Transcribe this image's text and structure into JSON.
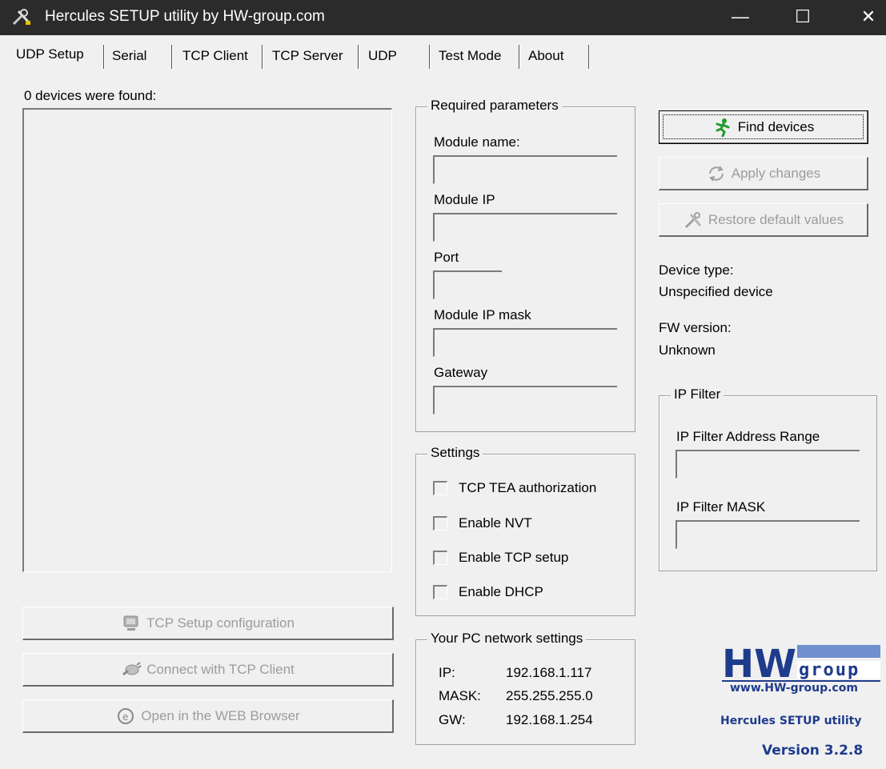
{
  "window": {
    "title": "Hercules SETUP utility by HW-group.com",
    "minimize": "—",
    "maximize": "☐",
    "close": "✕"
  },
  "tabs": [
    {
      "label": "UDP Setup",
      "active": true
    },
    {
      "label": "Serial"
    },
    {
      "label": "TCP Client"
    },
    {
      "label": "TCP Server"
    },
    {
      "label": "UDP"
    },
    {
      "label": "Test Mode"
    },
    {
      "label": "About"
    }
  ],
  "devices": {
    "found_label": "0 devices were found:",
    "items": []
  },
  "left_buttons": {
    "tcp_setup": "TCP Setup configuration",
    "connect_tcp": "Connect with TCP Client",
    "open_web": "Open in the WEB Browser"
  },
  "required": {
    "legend": "Required parameters",
    "module_name_label": "Module name:",
    "module_name_value": "",
    "module_ip_label": "Module IP",
    "module_ip_value": "",
    "port_label": "Port",
    "port_value": "",
    "mask_label": "Module IP mask",
    "mask_value": "",
    "gateway_label": "Gateway",
    "gateway_value": ""
  },
  "settings": {
    "legend": "Settings",
    "items": [
      {
        "label": "TCP TEA authorization",
        "checked": false
      },
      {
        "label": "Enable NVT",
        "checked": false
      },
      {
        "label": "Enable TCP setup",
        "checked": false
      },
      {
        "label": "Enable DHCP",
        "checked": false
      }
    ]
  },
  "pc_network": {
    "legend": "Your PC network settings",
    "ip_label": "IP:",
    "ip_value": "192.168.1.117",
    "mask_label": "MASK:",
    "mask_value": "255.255.255.0",
    "gw_label": "GW:",
    "gw_value": "192.168.1.254"
  },
  "right_buttons": {
    "find_devices": "Find devices",
    "apply_changes": "Apply changes",
    "restore_defaults": "Restore default values"
  },
  "device_info": {
    "type_label": "Device type:",
    "type_value": "Unspecified device",
    "fw_label": "FW version:",
    "fw_value": "Unknown"
  },
  "ip_filter": {
    "legend": "IP Filter",
    "range_label": "IP Filter Address Range",
    "range_value": "",
    "mask_label": "IP Filter MASK",
    "mask_value": ""
  },
  "branding": {
    "logo_text": "HW group",
    "url": "www.HW-group.com",
    "caption": "Hercules SETUP utility",
    "version": "Version  3.2.8"
  },
  "colors": {
    "titlebar": "#2b2b2b",
    "window_bg": "#f0f0f0",
    "brand_blue": "#1e3b8c",
    "disabled_text": "#9c9c9c"
  }
}
